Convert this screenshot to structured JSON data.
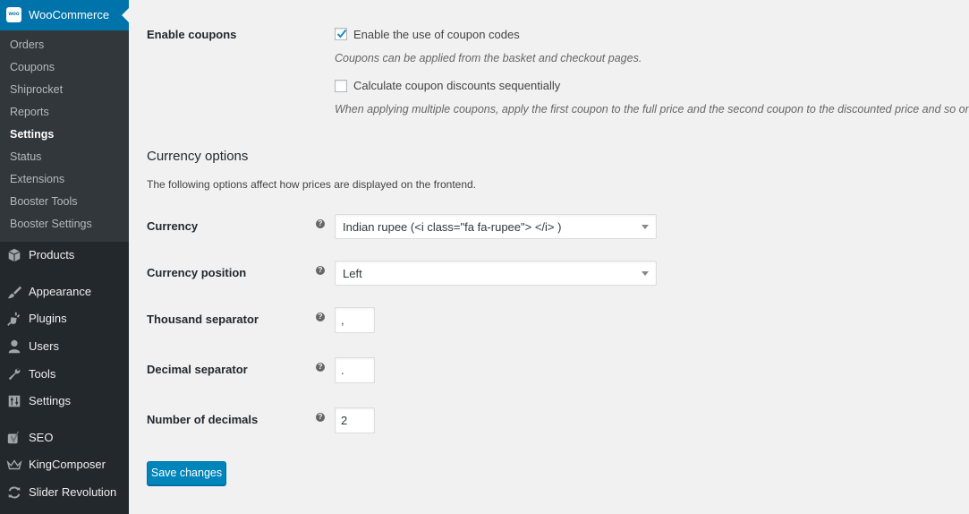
{
  "sidebar": {
    "woocommerce": {
      "logo_text": "woo",
      "label": "WooCommerce"
    },
    "submenu": [
      "Orders",
      "Coupons",
      "Shiprocket",
      "Reports",
      "Settings",
      "Status",
      "Extensions",
      "Booster Tools",
      "Booster Settings"
    ],
    "current_submenu": "Settings",
    "menu": [
      {
        "label": "Products",
        "icon": "box-icon"
      },
      {
        "label": "Appearance",
        "icon": "paintbrush-icon"
      },
      {
        "label": "Plugins",
        "icon": "plug-icon"
      },
      {
        "label": "Users",
        "icon": "user-icon"
      },
      {
        "label": "Tools",
        "icon": "wrench-icon"
      },
      {
        "label": "Settings",
        "icon": "settings-sliders-icon"
      },
      {
        "label": "SEO",
        "icon": "yoast-icon"
      },
      {
        "label": "KingComposer",
        "icon": "crown-icon"
      },
      {
        "label": "Slider Revolution",
        "icon": "refresh-icon"
      }
    ],
    "colors": {
      "bg": "#23282d",
      "submenu_bg": "#32373c",
      "active": "#0073aa"
    }
  },
  "coupons": {
    "label": "Enable coupons",
    "enable": {
      "text": "Enable the use of coupon codes",
      "checked": true
    },
    "enable_desc": "Coupons can be applied from the basket and checkout pages.",
    "sequential": {
      "text": "Calculate coupon discounts sequentially",
      "checked": false
    },
    "sequential_desc": "When applying multiple coupons, apply the first coupon to the full price and the second coupon to the discounted price and so on."
  },
  "currency_options": {
    "title": "Currency options",
    "description": "The following options affect how prices are displayed on the frontend.",
    "currency": {
      "label": "Currency",
      "value": "Indian rupee (<i class=\"fa fa-rupee\"> </i> )"
    },
    "position": {
      "label": "Currency position",
      "value": "Left"
    },
    "thousand_separator": {
      "label": "Thousand separator",
      "value": ","
    },
    "decimal_separator": {
      "label": "Decimal separator",
      "value": "."
    },
    "decimals": {
      "label": "Number of decimals",
      "value": "2"
    },
    "help_glyph": "?"
  },
  "save_button": {
    "label": "Save changes",
    "color": "#0085ba"
  }
}
